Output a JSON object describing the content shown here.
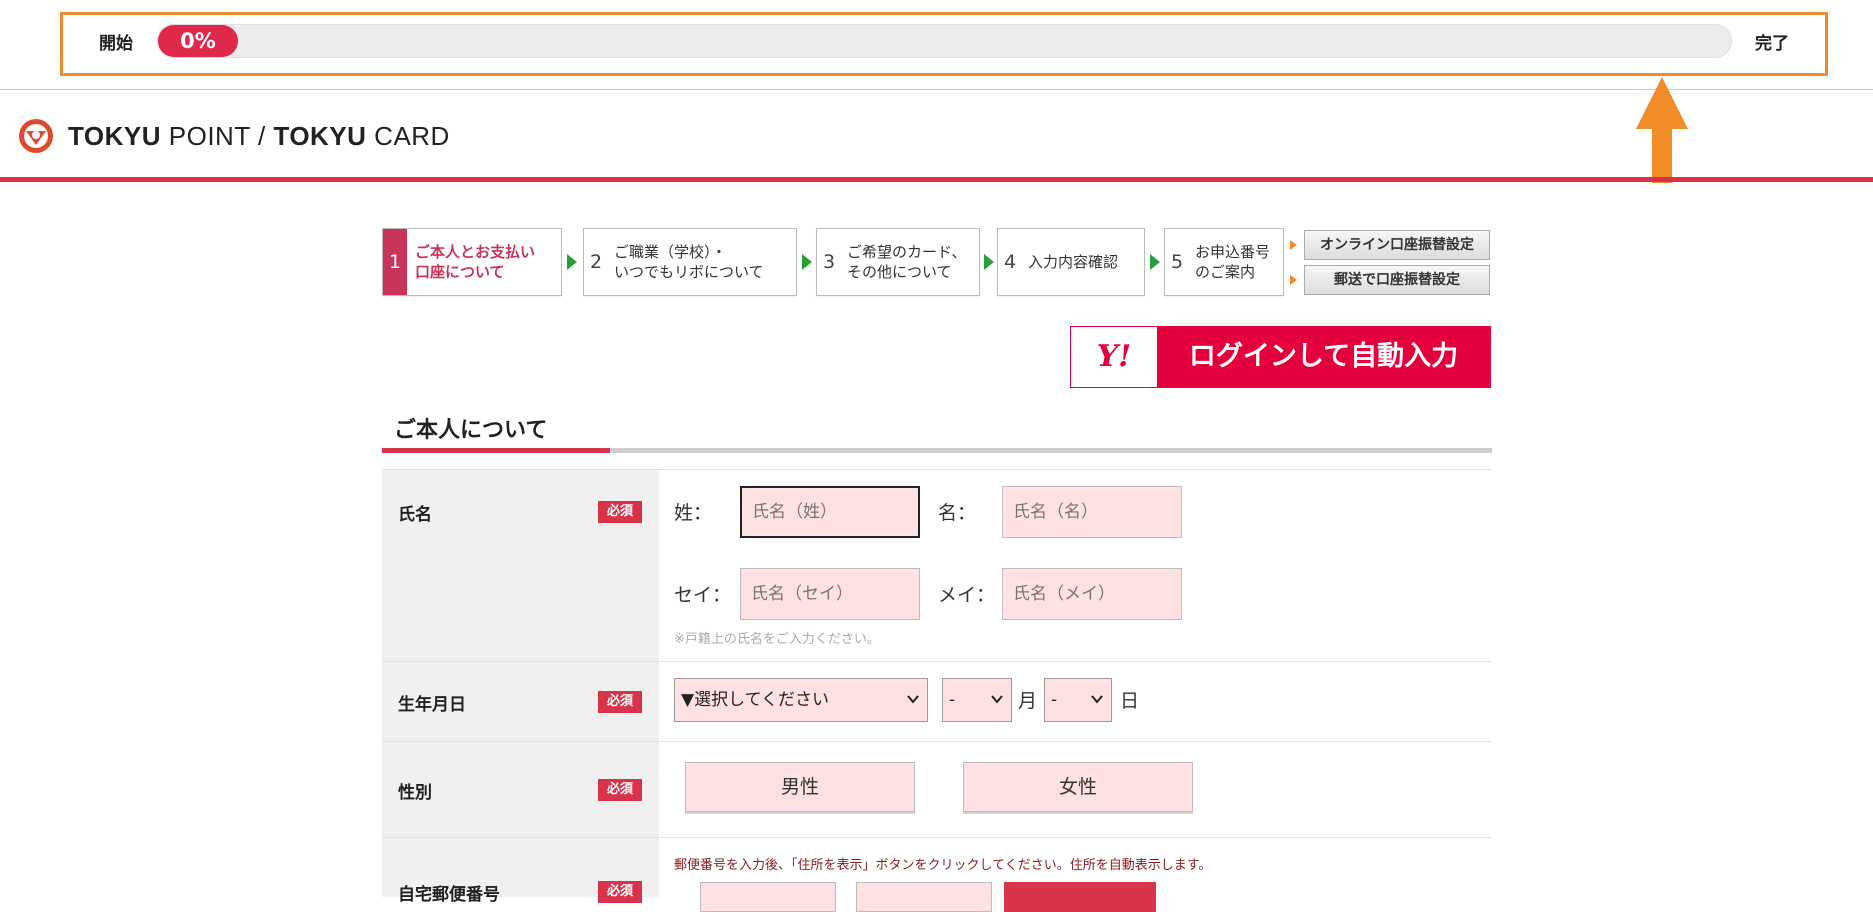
{
  "progress": {
    "start_label": "開始",
    "percent_label": "0%",
    "percent_value": 0,
    "end_label": "完了",
    "accent": "#e0284a",
    "frame_color": "#f08a2c"
  },
  "annotation": {
    "arrow_icon": "up-arrow-icon",
    "color": "#f28c28"
  },
  "header": {
    "logo_icon": "tokyu-logo-icon",
    "brand_bold_1": "TOKYU",
    "brand_1": " POINT",
    "separator": " / ",
    "brand_bold_2": "TOKYU",
    "brand_2": " CARD",
    "brand_color": "#d8334a"
  },
  "steps": [
    {
      "num": "1",
      "label_line1": "ご本人とお支払い",
      "label_line2": "口座について",
      "active": true
    },
    {
      "num": "2",
      "label_line1": "ご職業（学校）・",
      "label_line2": "いつでもリボについて",
      "active": false
    },
    {
      "num": "3",
      "label_line1": "ご希望のカード、",
      "label_line2": "その他について",
      "active": false
    },
    {
      "num": "4",
      "label_line1": "入力内容確認",
      "label_line2": "",
      "active": false
    },
    {
      "num": "5",
      "label_line1": "お申込番号",
      "label_line2": "のご案内",
      "active": false
    }
  ],
  "side_links": [
    {
      "label": "オンライン口座振替設定"
    },
    {
      "label": "郵送で口座振替設定"
    }
  ],
  "yahoo_button": {
    "logo": "Y!",
    "label": "ログインして自動入力",
    "color": "#e4003c"
  },
  "section": {
    "title": "ご本人について"
  },
  "required_badge": "必須",
  "name_row": {
    "label": "氏名",
    "sei_label": "姓：",
    "mei_label": "名：",
    "sei_kana_label": "セイ：",
    "mei_kana_label": "メイ：",
    "sei_placeholder": "氏名（姓）",
    "mei_placeholder": "氏名（名）",
    "sei_kana_placeholder": "氏名（セイ）",
    "mei_kana_placeholder": "氏名（メイ）",
    "note": "※戸籍上の氏名をご入力ください。"
  },
  "birth_row": {
    "label": "生年月日",
    "year_value": "▼選択してください",
    "month_value": "-",
    "month_unit": "月",
    "day_value": "-",
    "day_unit": "日"
  },
  "gender_row": {
    "label": "性別",
    "male": "男性",
    "female": "女性"
  },
  "postal_row": {
    "label": "自宅郵便番号",
    "note": "郵便番号を入力後、「住所を表示」ボタンをクリックしてください。住所を自動表示します。"
  }
}
